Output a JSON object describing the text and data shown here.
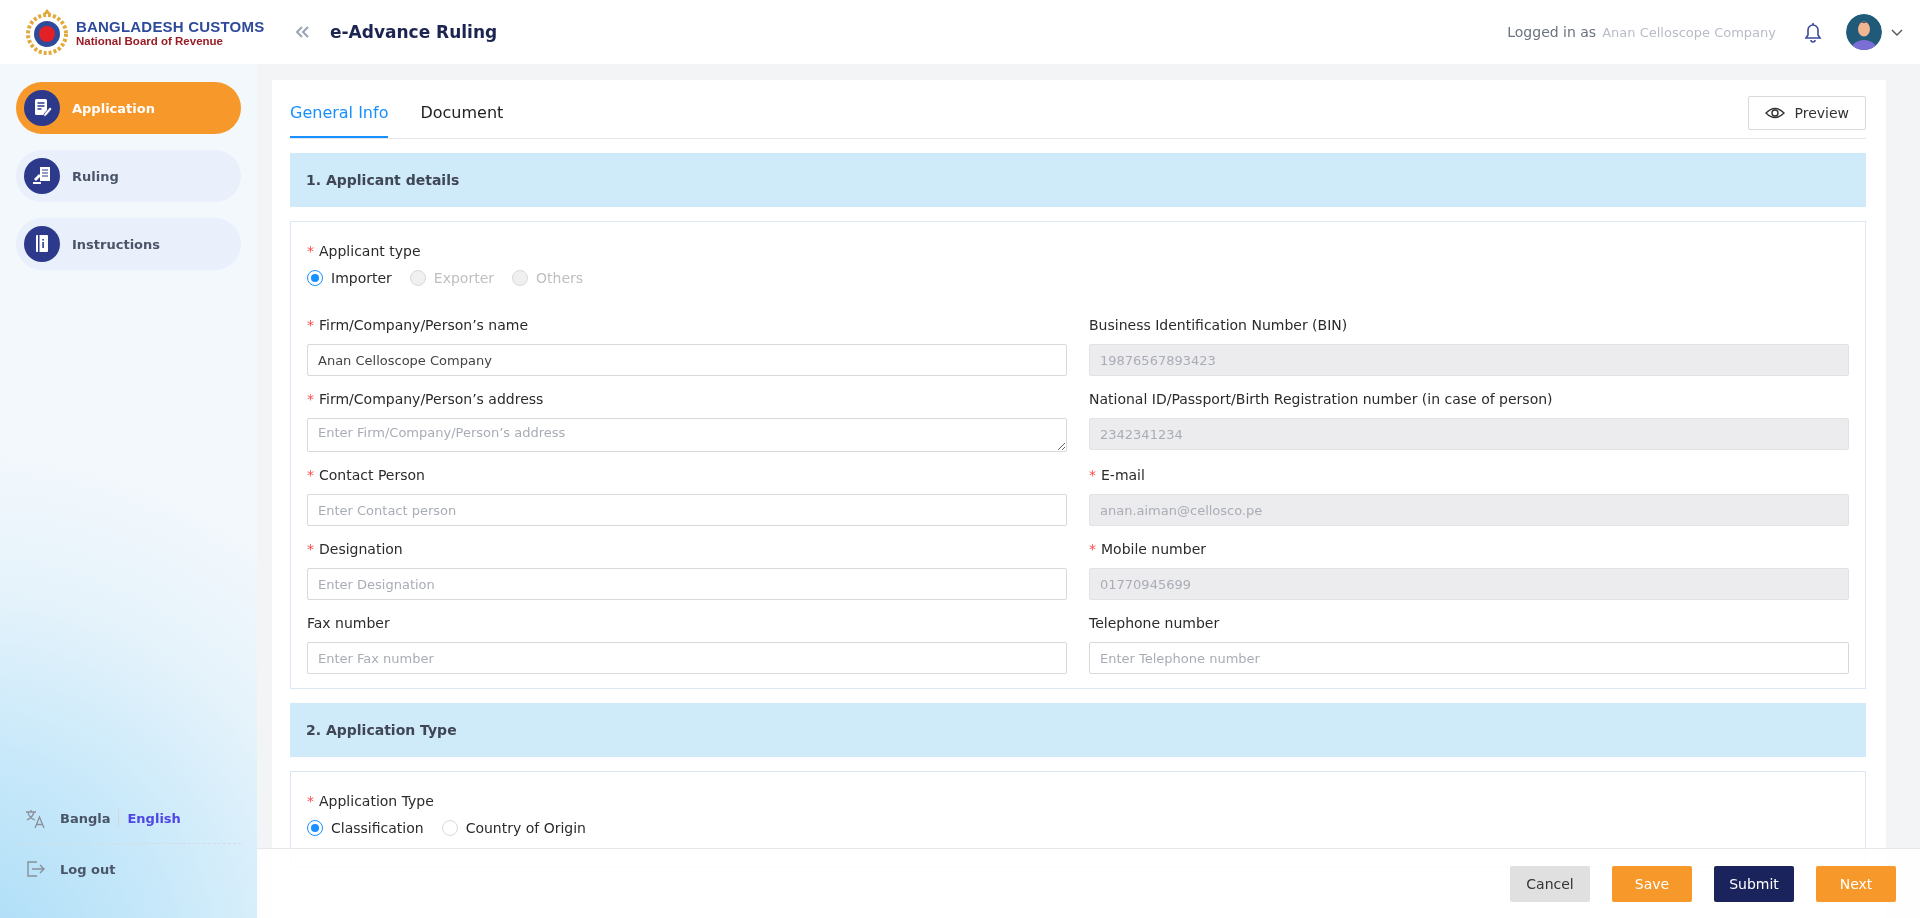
{
  "header": {
    "logo_title": "BANGLADESH CUSTOMS",
    "logo_subtitle": "National Board of Revenue",
    "page_title": "e-Advance Ruling",
    "logged_in_label": "Logged in as",
    "user_name": "Anan Celloscope Company"
  },
  "sidebar": {
    "items": [
      {
        "label": "Application",
        "selected": true
      },
      {
        "label": "Ruling",
        "selected": false
      },
      {
        "label": "Instructions",
        "selected": false
      }
    ],
    "languages": [
      {
        "label": "Bangla",
        "selected": false
      },
      {
        "label": "English",
        "selected": true
      }
    ],
    "logout": "Log out"
  },
  "tabs": [
    {
      "label": "General Info",
      "selected": true
    },
    {
      "label": "Document",
      "selected": false
    }
  ],
  "preview_button": "Preview",
  "sections": [
    {
      "title": "1. Applicant details",
      "fields": [
        {
          "kind": "radio",
          "marker": "*",
          "label": "Applicant type",
          "options": [
            {
              "label": "Importer",
              "selected": true,
              "disabled": false
            },
            {
              "label": "Exporter",
              "selected": false,
              "disabled": true
            },
            {
              "label": "Others",
              "selected": false,
              "disabled": true
            }
          ]
        },
        {
          "kind": "text",
          "marker": "*",
          "label": "Firm/Company/Person’s name",
          "value": "Anan Celloscope Company",
          "disabled": false
        },
        {
          "kind": "text",
          "label": "Business Identification Number (BIN)",
          "value": "19876567893423",
          "disabled": true
        },
        {
          "kind": "textarea",
          "marker": "*",
          "label": "Firm/Company/Person’s address",
          "placeholder": "Enter Firm/Company/Person’s address",
          "disabled": false
        },
        {
          "kind": "text",
          "label": "National ID/Passport/Birth Registration number (in case of person)",
          "value": "2342341234",
          "disabled": true
        },
        {
          "kind": "text",
          "marker": "*",
          "label": "Contact Person",
          "placeholder": "Enter Contact person",
          "disabled": false
        },
        {
          "kind": "text",
          "marker": "*",
          "label": "E-mail",
          "value": "anan.aiman@cellosco.pe",
          "disabled": true
        },
        {
          "kind": "text",
          "marker": "*",
          "label": "Designation",
          "placeholder": "Enter Designation",
          "disabled": false
        },
        {
          "kind": "text",
          "marker": "*",
          "label": "Mobile number",
          "value": "01770945699",
          "disabled": true
        },
        {
          "kind": "text",
          "label": "Fax number",
          "placeholder": "Enter Fax number",
          "disabled": false
        },
        {
          "kind": "text",
          "label": "Telephone number",
          "placeholder": "Enter Telephone number",
          "disabled": false
        }
      ]
    },
    {
      "title": "2. Application Type",
      "fields": [
        {
          "kind": "radio",
          "marker": "*",
          "label": "Application Type",
          "options": [
            {
              "label": "Classification",
              "selected": true,
              "disabled": false
            },
            {
              "label": "Country of Origin",
              "selected": false,
              "disabled": false
            }
          ]
        }
      ]
    }
  ],
  "footer_buttons": [
    {
      "label": "Cancel",
      "kind": "secondary"
    },
    {
      "label": "Save",
      "kind": "primary"
    },
    {
      "label": "Submit",
      "kind": "dark"
    },
    {
      "label": "Next",
      "kind": "primary"
    }
  ]
}
